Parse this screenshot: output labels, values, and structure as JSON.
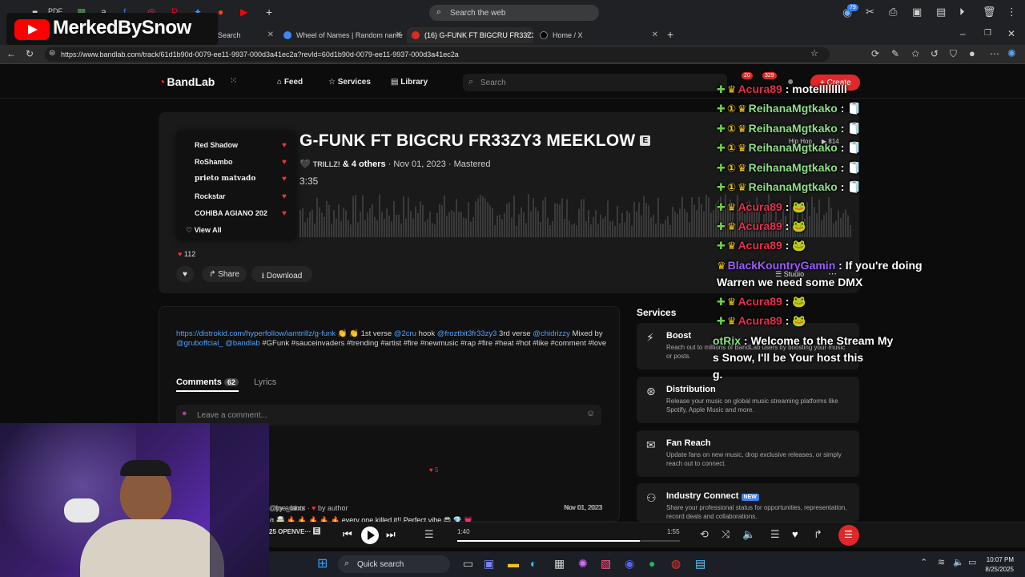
{
  "browser": {
    "top_search_placeholder": "Search the web",
    "top_search_badge": "79",
    "tabs": [
      {
        "label": "Search",
        "active": false
      },
      {
        "label": "Wheel of Names | Random name",
        "active": false
      },
      {
        "label": "(16) G-FUNK FT BIGCRU FR33Z3",
        "active": true
      },
      {
        "label": "Home / X",
        "active": false
      }
    ],
    "url": "https://www.bandlab.com/track/61d1b90d-0079-ee11-9937-000d3a41ec2a?revId=60d1b90d-0079-ee11-9937-000d3a41ec2a",
    "pdf_label": "PDF"
  },
  "banner": {
    "name": "MerkedBySnow"
  },
  "nav": {
    "logo": "BandLab",
    "feed": "Feed",
    "services": "Services",
    "library": "Library",
    "search_placeholder": "Search",
    "notif_count": "20",
    "msg_count": "329",
    "create": "+ Create"
  },
  "track": {
    "title": "G-FUNK FT BIGCRU FR33ZY3 MEEKLOW",
    "explicit": "E",
    "artist": "TRILLZ!",
    "others": "& 4 others",
    "date": "· Nov 01, 2023 · Mastered",
    "duration": "3:35",
    "genre": "Hip Hop",
    "plays": "814",
    "likes": "112",
    "share": "Share",
    "download": "Download",
    "studio": "Studio",
    "likers": [
      "Red Shadow",
      "RoShambo",
      "prieto matvado",
      "Rockstar",
      "COHIBA AGIANO 202"
    ],
    "view_all": "View All"
  },
  "description": {
    "link": "https://distrokid.com/hyperfollow/iamtrillz/g-funk",
    "part1": " 👏 👏 1st verse ",
    "m1": "@2cru",
    "part2": " hook ",
    "m2": "@froztbit3fr33zy3",
    "part3": " 3rd verse ",
    "m3": "@chidrizzy",
    "part4": " Mixed by ",
    "m4": "@gruboffcial_",
    "m5": "@bandlab",
    "tags": " #GFunk #sauceinvaders #trending #artist #fire #newmusic #rap  #fire #heat #hot #like #comment #love"
  },
  "comments": {
    "tab_comments": "Comments",
    "count": "62",
    "tab_lyrics": "Lyrics",
    "placeholder": "Leave a comment...",
    "items": [
      {
        "by": "by author",
        "text": "g 🤯 🔥 🔥 🔥 🔥 🔥 every one killed it!! Perfect vibe 😎 💎 💗",
        "date": "Nov 01, 2023",
        "likes": "5"
      },
      {
        "user": "@joe_facts",
        "by": "by author",
        "date": "Nov 01, 2023"
      }
    ]
  },
  "services": {
    "heading": "Services",
    "items": [
      {
        "title": "Boost",
        "desc": "Reach out to millions of BandLab users by boosting your music or posts."
      },
      {
        "title": "Distribution",
        "desc": "Release your music on global music streaming platforms like Spotify, Apple Music and more."
      },
      {
        "title": "Fan Reach",
        "desc": "Update fans on new music, drop exclusive releases, or simply reach out to connect."
      },
      {
        "title": "Industry Connect",
        "badge": "NEW",
        "desc": "Share your professional status for opportunities, representation, record deals and collaborations."
      }
    ]
  },
  "chat": [
    {
      "name": "Acura89",
      "color": "red",
      "msg": ": motelllllllll"
    },
    {
      "name": "ReihanaMgtkako",
      "color": "green",
      "msg": ":"
    },
    {
      "name": "ReihanaMgtkako",
      "color": "green",
      "msg": ":"
    },
    {
      "name": "ReihanaMgtkako",
      "color": "green",
      "msg": ":"
    },
    {
      "name": "ReihanaMgtkako",
      "color": "green",
      "msg": ":"
    },
    {
      "name": "ReihanaMgtkako",
      "color": "green",
      "msg": ":"
    },
    {
      "name": "Acura89",
      "color": "red",
      "msg": ":"
    },
    {
      "name": "Acura89",
      "color": "red",
      "msg": ":"
    },
    {
      "name": "Acura89",
      "color": "red",
      "msg": ":"
    },
    {
      "name": "BlackKountryGamin",
      "color": "purple",
      "msg": ": If you're doing"
    },
    {
      "name": "",
      "color": "none",
      "msg": "Warren we need some DMX"
    },
    {
      "name": "Acura89",
      "color": "red",
      "msg": ":"
    },
    {
      "name": "Acura89",
      "color": "red",
      "msg": ":"
    },
    {
      "name": "otRix",
      "color": "green",
      "msg": ": Welcome to the Stream My"
    },
    {
      "name": "",
      "color": "none",
      "msg": "s Snow, I'll be Your host this"
    },
    {
      "name": "",
      "color": "none",
      "msg": "g."
    }
  ],
  "player": {
    "track": "25 OPENVE···",
    "explicit": "E",
    "elapsed": "1:40",
    "total": "1:55",
    "progress": 0.82
  },
  "taskbar": {
    "search": "Quick search",
    "time": "10:07 PM",
    "date": "8/25/2025"
  },
  "colors": {
    "accent": "#e02828",
    "link": "#4ea1ff",
    "chat_red": "#e62e4a",
    "chat_green": "#8ddf86",
    "chat_purple": "#9a5cff"
  }
}
